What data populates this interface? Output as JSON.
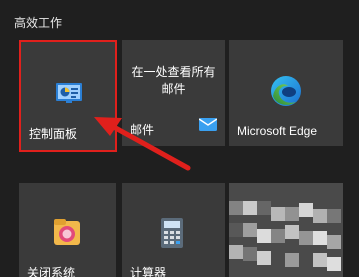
{
  "group_title": "高效工作",
  "tiles": [
    {
      "label": "控制面板"
    },
    {
      "title": "在一处查看所有邮件",
      "label": "邮件"
    },
    {
      "label": "Microsoft Edge"
    },
    {
      "label": "关闭系统"
    },
    {
      "label": "计算器"
    }
  ],
  "colors": {
    "highlight": "#e0201c",
    "tile": "#3a3a3a",
    "background": "#1f1f1f"
  }
}
